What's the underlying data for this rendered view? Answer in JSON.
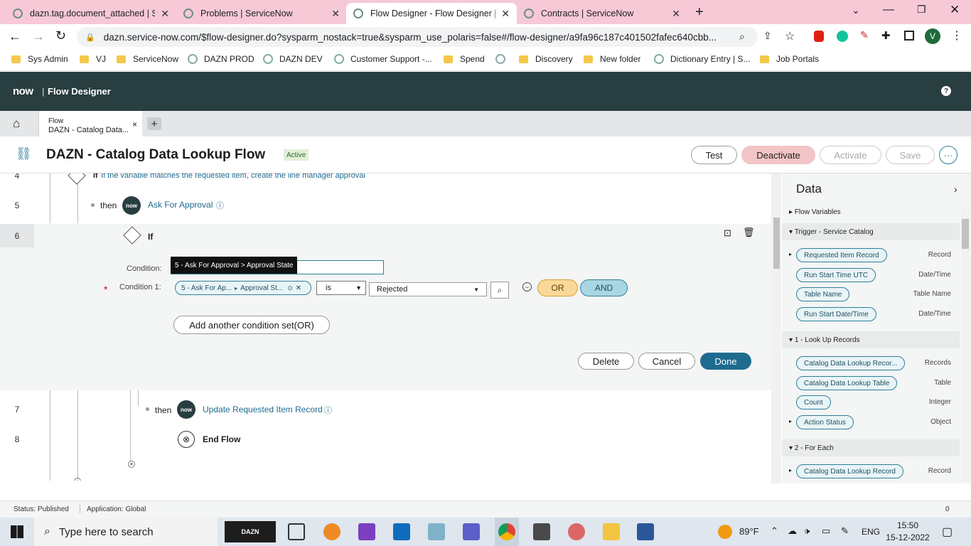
{
  "browser": {
    "tabs": [
      {
        "title": "dazn.tag.document_attached | Sy"
      },
      {
        "title": "Problems | ServiceNow"
      },
      {
        "title": "Flow Designer - Flow Designer | D"
      },
      {
        "title": "Contracts | ServiceNow"
      }
    ],
    "url": "dazn.service-now.com/$flow-designer.do?sysparm_nostack=true&sysparm_use_polaris=false#/flow-designer/a9fa96c187c401502fafec640cbb...",
    "bookmarks": [
      "Sys Admin",
      "VJ",
      "ServiceNow",
      "DAZN PROD",
      "DAZN DEV",
      "Customer Support -...",
      "Spend",
      "",
      "Discovery",
      "New folder",
      "Dictionary Entry | S...",
      "Job Portals"
    ],
    "profile_initial": "V"
  },
  "app": {
    "logo": "now",
    "product": "Flow Designer",
    "help": "?"
  },
  "flowtab": {
    "type": "Flow",
    "name": "DAZN - Catalog Data...",
    "close": "×",
    "add": "+"
  },
  "title": {
    "name": "DAZN - Catalog Data Lookup Flow",
    "badge": "Active",
    "test": "Test",
    "deactivate": "Deactivate",
    "activate": "Activate",
    "save": "Save",
    "more": "···"
  },
  "canvas": {
    "row4": {
      "num": "4",
      "text": "If the variable matches the requested item, create the line manager approval",
      "prefix": "If"
    },
    "row5": {
      "num": "5",
      "then": "then",
      "action": "Ask For Approval"
    },
    "row6": {
      "num": "6",
      "if": "If"
    },
    "tooltip": "5 - Ask For Approval > Approval State",
    "condition_label": "Condition:",
    "required": "*",
    "condition1_label": "Condition 1:",
    "cond_pill_a": "5 - Ask For Ap...",
    "cond_pill_b": "Approval St...",
    "operator": "is",
    "value": "Rejected",
    "or": "OR",
    "and": "AND",
    "add_set": "Add another condition set(OR)",
    "delete": "Delete",
    "cancel": "Cancel",
    "done": "Done",
    "row7": {
      "num": "7",
      "then": "then",
      "action": "Update Requested Item Record"
    },
    "row8": {
      "num": "8",
      "action": "End Flow"
    }
  },
  "data_panel": {
    "title": "Data",
    "flow_vars": "Flow Variables",
    "trigger": "Trigger - Service Catalog",
    "trigger_items": [
      {
        "label": "Requested Item Record",
        "type": "Record"
      },
      {
        "label": "Run Start Time UTC",
        "type": "Date/Time"
      },
      {
        "label": "Table Name",
        "type": "Table Name"
      },
      {
        "label": "Run Start Date/Time",
        "type": "Date/Time"
      }
    ],
    "lookup": "1 - Look Up Records",
    "lookup_items": [
      {
        "label": "Catalog Data Lookup Recor...",
        "type": "Records"
      },
      {
        "label": "Catalog Data Lookup Table",
        "type": "Table"
      },
      {
        "label": "Count",
        "type": "Integer"
      },
      {
        "label": "Action Status",
        "type": "Object"
      }
    ],
    "foreach": "2 - For Each",
    "foreach_items": [
      {
        "label": "Catalog Data Lookup Record",
        "type": "Record"
      }
    ]
  },
  "status": {
    "state": "Status: Published",
    "application": "Application: Global",
    "count": "0"
  },
  "taskbar": {
    "search": "Type here to search",
    "weather": "89°F",
    "lang": "ENG",
    "time": "15:50",
    "date": "15-12-2022"
  }
}
